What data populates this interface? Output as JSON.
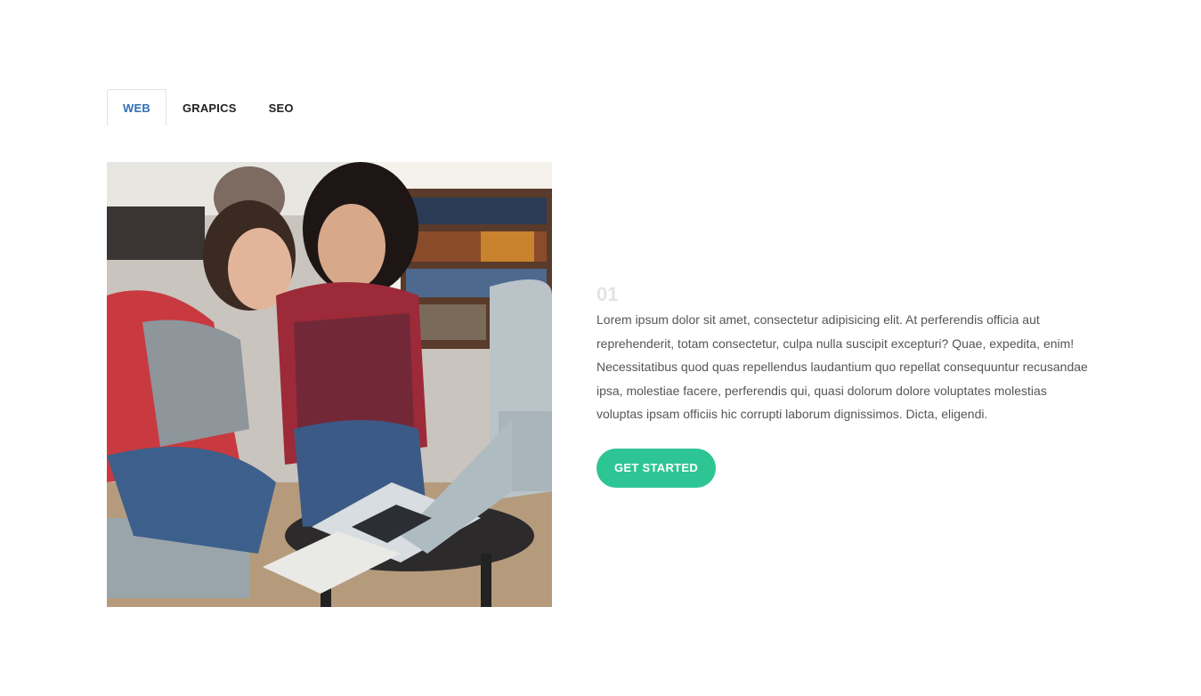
{
  "tabs": [
    {
      "label": "WEB",
      "active": true
    },
    {
      "label": "GRAPICS",
      "active": false
    },
    {
      "label": "SEO",
      "active": false
    }
  ],
  "feature": {
    "number": "01",
    "description": "Lorem ipsum dolor sit amet, consectetur adipisicing elit. At perferendis officia aut reprehenderit, totam consectetur, culpa nulla suscipit excepturi? Quae, expedita, enim! Necessitatibus quod quas repellendus laudantium quo repellat consequuntur recusandae ipsa, molestiae facere, perferendis qui, quasi dolorum dolore voluptates molestias voluptas ipsam officiis hic corrupti laborum dignissimos. Dicta, eligendi.",
    "button_label": "GET STARTED"
  },
  "colors": {
    "active_tab": "#2f6fb8",
    "button": "#2ec594"
  }
}
